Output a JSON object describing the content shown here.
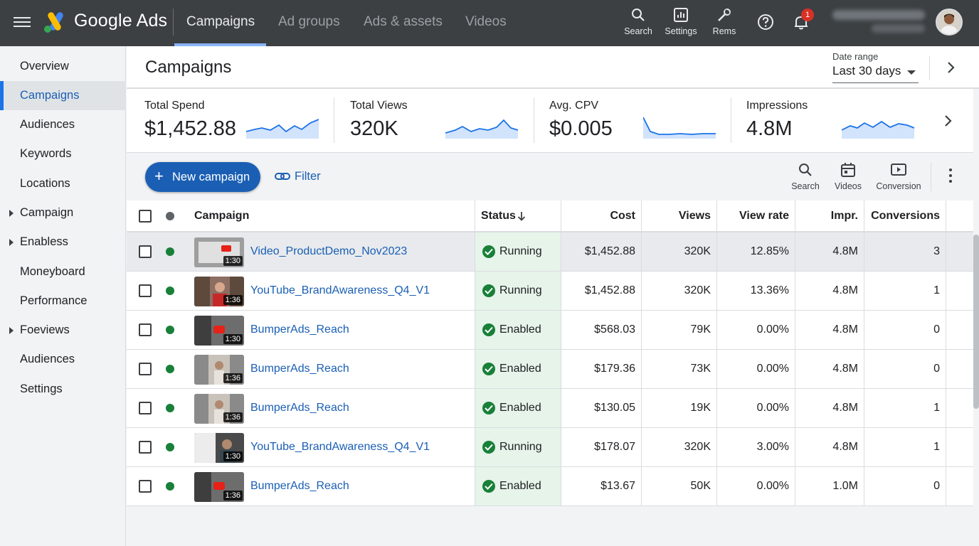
{
  "app": {
    "brand": "Google Ads"
  },
  "nav_tabs": [
    {
      "label": "Campaigns",
      "active": true
    },
    {
      "label": "Ad groups"
    },
    {
      "label": "Ads & assets"
    },
    {
      "label": "Videos"
    }
  ],
  "top_icons": {
    "search": "Search",
    "settings": "Settings",
    "tools": "Rems"
  },
  "notifications": {
    "count": "1"
  },
  "sidebar": {
    "items": [
      {
        "label": "Overview"
      },
      {
        "label": "Campaigns",
        "active": true
      },
      {
        "label": "Audiences"
      },
      {
        "label": "Keywords"
      },
      {
        "label": "Locations"
      },
      {
        "label": "Campaign",
        "expandable": true
      },
      {
        "label": "Enabless",
        "expandable": true
      },
      {
        "label": "Moneyboard"
      },
      {
        "label": "Performance"
      },
      {
        "label": "Foeviews",
        "expandable": true
      },
      {
        "label": "Audiences"
      },
      {
        "label": "Settings"
      }
    ]
  },
  "header": {
    "title": "Campaigns",
    "date_range_label": "Date range",
    "date_range_value": "Last 30 days"
  },
  "stats": [
    {
      "label": "Total Spend",
      "value": "$1,452.88"
    },
    {
      "label": "Total Views",
      "value": "320K"
    },
    {
      "label": "Avg. CPV",
      "value": "$0.005"
    },
    {
      "label": "Impressions",
      "value": "4.8M"
    }
  ],
  "toolbar": {
    "new_campaign": "New campaign",
    "filter": "Filter",
    "icons": {
      "search": "Search",
      "videos": "Videos",
      "conversion": "Conversion"
    }
  },
  "table": {
    "headers": {
      "campaign": "Campaign",
      "status": "Status",
      "cost": "Cost",
      "views": "Views",
      "view_rate": "View rate",
      "impr": "Impr.",
      "conversions": "Conversions"
    },
    "rows": [
      {
        "duration": "1:30",
        "name": "Video_ProductDemo_Nov2023",
        "status": "Running",
        "cost": "$1,452.88",
        "views": "320K",
        "view_rate": "12.85%",
        "impr": "4.8M",
        "conversions": "3"
      },
      {
        "duration": "1:36",
        "name": "YouTube_BrandAwareness_Q4_V1",
        "status": "Running",
        "cost": "$1,452.88",
        "views": "320K",
        "view_rate": "13.36%",
        "impr": "4.8M",
        "conversions": "1"
      },
      {
        "duration": "1:30",
        "name": "BumperAds_Reach",
        "status": "Enabled",
        "cost": "$568.03",
        "views": "79K",
        "view_rate": "0.00%",
        "impr": "4.8M",
        "conversions": "0"
      },
      {
        "duration": "1:36",
        "name": "BumperAds_Reach",
        "status": "Enabled",
        "cost": "$179.36",
        "views": "73K",
        "view_rate": "0.00%",
        "impr": "4.8M",
        "conversions": "0"
      },
      {
        "duration": "1:36",
        "name": "BumperAds_Reach",
        "status": "Enabled",
        "cost": "$130.05",
        "views": "19K",
        "view_rate": "0.00%",
        "impr": "4.8M",
        "conversions": "1"
      },
      {
        "duration": "1:30",
        "name": "YouTube_BrandAwareness_Q4_V1",
        "status": "Running",
        "cost": "$178.07",
        "views": "320K",
        "view_rate": "3.00%",
        "impr": "4.8M",
        "conversions": "1"
      },
      {
        "duration": "1:36",
        "name": "BumperAds_Reach",
        "status": "Enabled",
        "cost": "$13.67",
        "views": "50K",
        "view_rate": "0.00%",
        "impr": "1.0M",
        "conversions": "0"
      }
    ]
  },
  "colors": {
    "topbar": "#3c4043",
    "accent": "#1a5fb4",
    "status_green": "#188038",
    "status_bg": "#e6f4ea",
    "notification_red": "#d93025"
  }
}
